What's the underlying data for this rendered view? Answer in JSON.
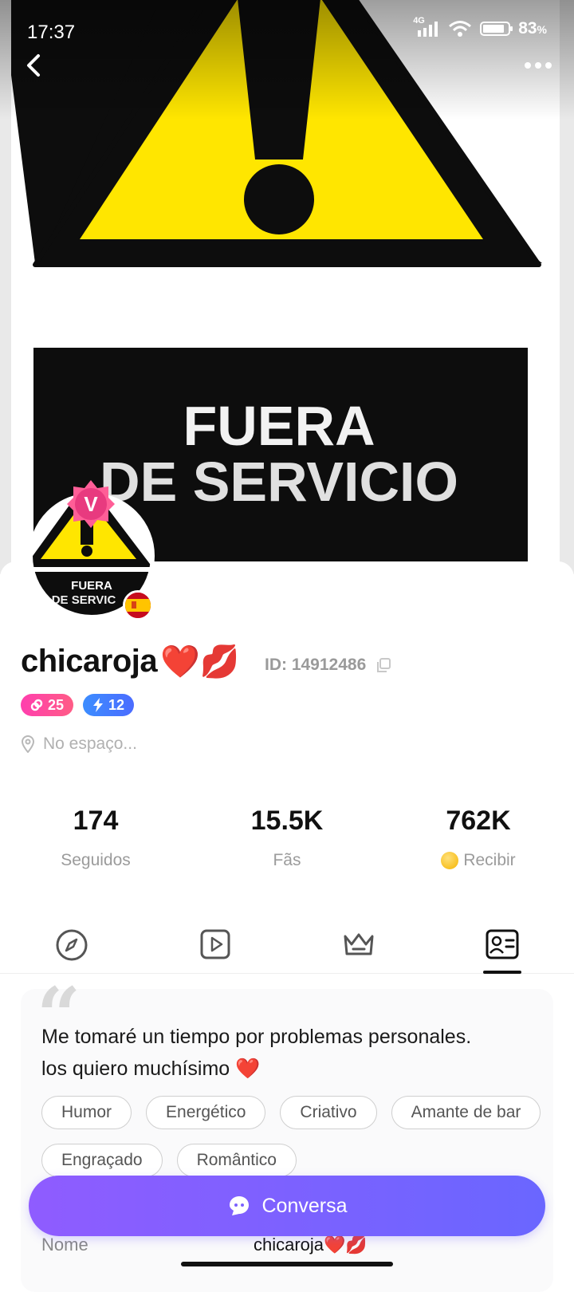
{
  "status_bar": {
    "time": "17:37",
    "network": "4G",
    "battery_percent": "83",
    "battery_unit": "%"
  },
  "hero": {
    "sign_line1": "FUERA",
    "sign_line2": "DE SERVICIO"
  },
  "avatar": {
    "sign_line1": "FUERA",
    "sign_line2": "DE SERVIC",
    "vip_letter": "V",
    "flag": "spain-flag-icon"
  },
  "profile": {
    "username": "chicaroja",
    "username_emojis": "❤️💋",
    "id_label": "ID: 14912486",
    "level_badge": "25",
    "energy_badge": "12",
    "location": "No espaço..."
  },
  "stats": [
    {
      "value": "174",
      "label": "Seguidos"
    },
    {
      "value": "15.5K",
      "label": "Fãs"
    },
    {
      "value": "762K",
      "label": "Recibir"
    }
  ],
  "tabs": {
    "items": [
      "compass-icon",
      "video-icon",
      "crown-icon",
      "profile-card-icon"
    ],
    "active_index": 3
  },
  "about": {
    "quote": "“",
    "bio_line1": "Me tomaré un tiempo por problemas personales.",
    "bio_line2": "los quiero muchísimo ❤️",
    "tags": [
      "Humor",
      "Energético",
      "Criativo",
      "Amante de bar",
      "Engraçado",
      "Romântico"
    ],
    "name_label": "Nome",
    "name_value": "chicaroja❤️💋"
  },
  "chat_button": {
    "label": "Conversa"
  },
  "colors": {
    "sign_yellow": "#ffe600",
    "chat_gradient_start": "#8f5cff",
    "chat_gradient_end": "#6a66ff",
    "level_pink": "#ff3fae",
    "energy_blue": "#3c8dff"
  }
}
